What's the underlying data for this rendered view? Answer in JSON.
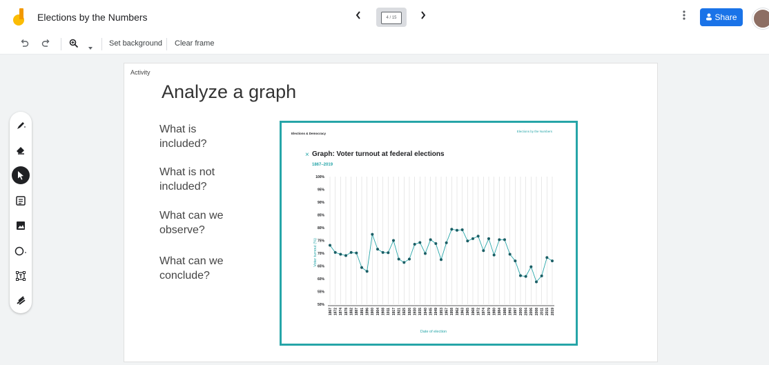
{
  "header": {
    "title": "Elections by the Numbers",
    "frame_counter": "4 / 15",
    "share_label": "Share",
    "prev_icon": "‹",
    "next_icon": "›"
  },
  "toolbar": {
    "set_background": "Set background",
    "clear_frame": "Clear frame"
  },
  "slide": {
    "activity_label": "Activity",
    "heading": "Analyze a graph",
    "questions": [
      [
        "What is",
        "included?"
      ],
      [
        "What is not",
        "included?"
      ],
      [
        "What can we",
        "observe?"
      ],
      [
        "What can we",
        "conclude?"
      ]
    ]
  },
  "graph": {
    "brand": "Elections & Democracy",
    "site_title": "Elections by the Numbers",
    "title": "Graph: Voter turnout at federal elections",
    "subtitle": "1867–2019",
    "ylabel": "Voter turnout (%)",
    "xlabel": "Date of election",
    "accent": "#26a5a8",
    "point_color": "#1b5e65"
  },
  "chart_data": {
    "type": "line",
    "title": "Graph: Voter turnout at federal elections",
    "subtitle": "1867–2019",
    "xlabel": "Date of election",
    "ylabel": "Voter turnout (%)",
    "ylim": [
      50,
      100
    ],
    "yticks": [
      "50%",
      "55%",
      "60%",
      "65%",
      "70%",
      "75%",
      "80%",
      "85%",
      "90%",
      "95%",
      "100%"
    ],
    "grid": true,
    "x": [
      "1867",
      "1872",
      "1874",
      "1878",
      "1882",
      "1887",
      "1891",
      "1896",
      "1900",
      "1904",
      "1908",
      "1911",
      "1917",
      "1921",
      "1925",
      "1926",
      "1930",
      "1935",
      "1940",
      "1945",
      "1949",
      "1953",
      "1957",
      "1958",
      "1962",
      "1963",
      "1965",
      "1968",
      "1972",
      "1974",
      "1979",
      "1980",
      "1984",
      "1988",
      "1993",
      "1997",
      "2000",
      "2004",
      "2006",
      "2008",
      "2011",
      "2015",
      "2019"
    ],
    "values": [
      73.1,
      70.3,
      69.6,
      69.1,
      70.3,
      70.1,
      64.4,
      62.9,
      77.4,
      71.6,
      70.3,
      70.2,
      75.0,
      67.7,
      66.4,
      67.7,
      73.5,
      74.2,
      69.9,
      75.3,
      73.8,
      67.5,
      74.1,
      79.4,
      79.0,
      79.2,
      74.8,
      75.7,
      76.7,
      71.0,
      75.7,
      69.3,
      75.3,
      75.3,
      69.6,
      67.0,
      61.2,
      60.9,
      64.7,
      58.8,
      61.1,
      68.3,
      67.0
    ]
  }
}
